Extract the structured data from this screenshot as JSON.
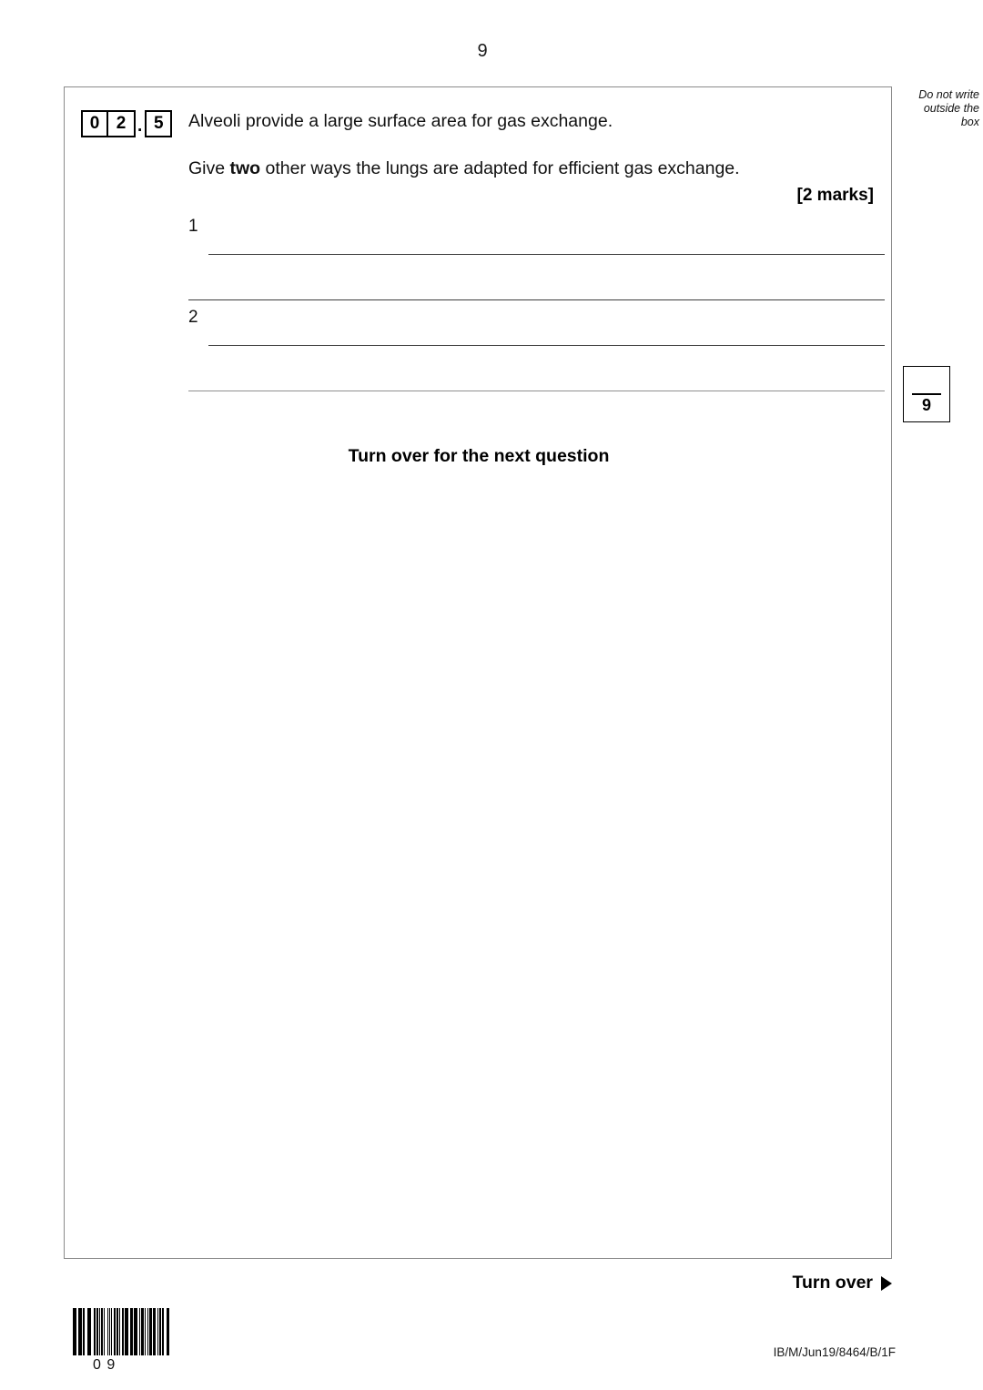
{
  "page": {
    "number": "9",
    "doc_code": "IB/M/Jun19/8464/B/1F"
  },
  "outside_note": {
    "line1": "Do not write",
    "line2": "outside the",
    "line3": "box"
  },
  "question": {
    "number_digits": [
      "0",
      "2"
    ],
    "separator": ".",
    "sub_digit": "5",
    "stem": "Alveoli provide a large surface area for gas exchange.",
    "instruction_prefix": "Give ",
    "instruction_bold": "two",
    "instruction_suffix": " other ways the lungs are adapted for efficient gas exchange.",
    "marks": "[2 marks]",
    "answers": [
      {
        "label": "1",
        "value": ""
      },
      {
        "label": "",
        "value": ""
      },
      {
        "label": "2",
        "value": ""
      },
      {
        "label": "",
        "value": ""
      }
    ]
  },
  "next_question_note": "Turn over for the next question",
  "marks_box": {
    "value": "9"
  },
  "footer": {
    "turn_over": "Turn over",
    "arrow_icon": "arrow-right-icon"
  },
  "barcode": {
    "digits": "0  9",
    "pattern": [
      3,
      1,
      1,
      2,
      3,
      1,
      1,
      1,
      2,
      2,
      1,
      1,
      4,
      1,
      1,
      2,
      2,
      1,
      3,
      1,
      1,
      1,
      2,
      2,
      1,
      3,
      1,
      1,
      2,
      1,
      1,
      2,
      3,
      1,
      2,
      1,
      1,
      3,
      2,
      1,
      1,
      1,
      3,
      2,
      1,
      1,
      2,
      1,
      3,
      1,
      1,
      2,
      1,
      1,
      4,
      1,
      1,
      2,
      2,
      1,
      3,
      1,
      1,
      1,
      2,
      2,
      1,
      1,
      3,
      1,
      2,
      1,
      1,
      2,
      3
    ]
  }
}
